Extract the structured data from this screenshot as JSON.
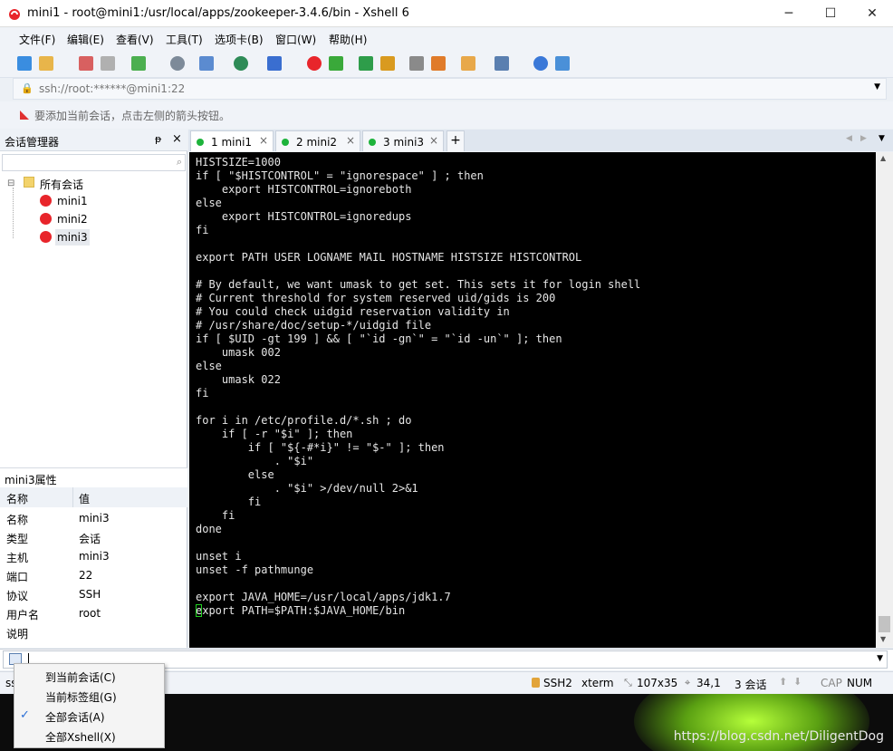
{
  "window": {
    "title": "mini1 - root@mini1:/usr/local/apps/zookeeper-3.4.6/bin - Xshell 6",
    "min": "─",
    "max": "☐",
    "close": "✕"
  },
  "menu": [
    "文件(F)",
    "编辑(E)",
    "查看(V)",
    "工具(T)",
    "选项卡(B)",
    "窗口(W)",
    "帮助(H)"
  ],
  "address": {
    "value": "ssh://root:******@mini1:22"
  },
  "hint": "要添加当前会话，点击左侧的箭头按钮。",
  "session_manager": {
    "title": "会话管理器",
    "pin": "ᵽ",
    "close": "×",
    "root": "所有会话",
    "items": [
      "mini1",
      "mini2",
      "mini3"
    ]
  },
  "properties": {
    "title": "mini3属性",
    "col_name": "名称",
    "col_value": "值",
    "rows": [
      {
        "k": "名称",
        "v": "mini3"
      },
      {
        "k": "类型",
        "v": "会话"
      },
      {
        "k": "主机",
        "v": "mini3"
      },
      {
        "k": "端口",
        "v": "22"
      },
      {
        "k": "协议",
        "v": "SSH"
      },
      {
        "k": "用户名",
        "v": "root"
      },
      {
        "k": "说明",
        "v": ""
      }
    ]
  },
  "tabs": [
    {
      "label": "1 mini1"
    },
    {
      "label": "2 mini2"
    },
    {
      "label": "3 mini3"
    }
  ],
  "tab_add": "+",
  "terminal": "HISTSIZE=1000\nif [ \"$HISTCONTROL\" = \"ignorespace\" ] ; then\n    export HISTCONTROL=ignoreboth\nelse\n    export HISTCONTROL=ignoredups\nfi\n\nexport PATH USER LOGNAME MAIL HOSTNAME HISTSIZE HISTCONTROL\n\n# By default, we want umask to get set. This sets it for login shell\n# Current threshold for system reserved uid/gids is 200\n# You could check uidgid reservation validity in\n# /usr/share/doc/setup-*/uidgid file\nif [ $UID -gt 199 ] && [ \"`id -gn`\" = \"`id -un`\" ]; then\n    umask 002\nelse\n    umask 022\nfi\n\nfor i in /etc/profile.d/*.sh ; do\n    if [ -r \"$i\" ]; then\n        if [ \"${-#*i}\" != \"$-\" ]; then\n            . \"$i\"\n        else\n            . \"$i\" >/dev/null 2>&1\n        fi\n    fi\ndone\n\nunset i\nunset -f pathmunge\n\nexport JAVA_HOME=/usr/local/apps/jdk1.7\nexport PATH=$PATH:$JAVA_HOME/bin",
  "status": {
    "left": "ss",
    "proto": "SSH2",
    "term": "xterm",
    "size": "107x35",
    "pos": "34,1",
    "sessions": "3 会话",
    "cap": "CAP",
    "num": "NUM"
  },
  "dropdown": {
    "items": [
      "到当前会话(C)",
      "当前标签组(G)",
      "全部会话(A)",
      "全部Xshell(X)"
    ],
    "checked_index": 2,
    "check": "✓"
  },
  "watermark": "https://blog.csdn.net/DiligentDog"
}
